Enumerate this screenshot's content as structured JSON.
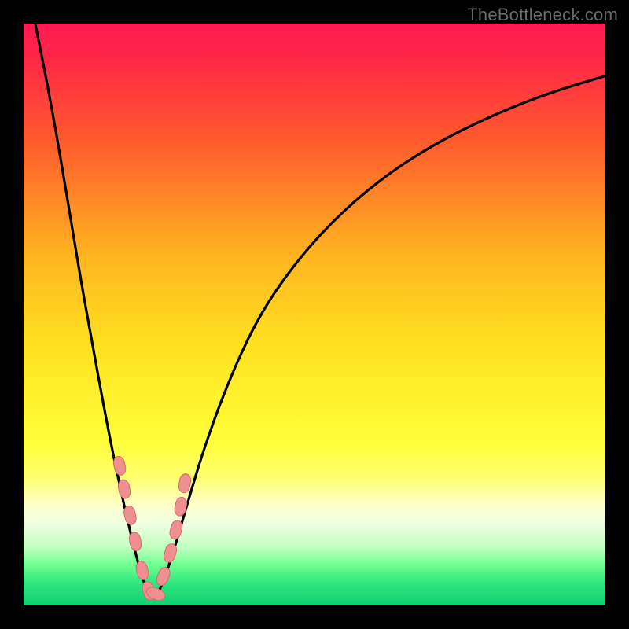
{
  "watermark": {
    "text": "TheBottleneck.com"
  },
  "colors": {
    "black": "#000000",
    "curve": "#000000",
    "marker_fill": "#ef8f8f",
    "marker_stroke": "#d46b6b",
    "gradient_stops": [
      {
        "pos": 0.0,
        "color": "#ff1a52"
      },
      {
        "pos": 0.05,
        "color": "#ff2448"
      },
      {
        "pos": 0.2,
        "color": "#ff5a2e"
      },
      {
        "pos": 0.4,
        "color": "#ffb520"
      },
      {
        "pos": 0.55,
        "color": "#ffe020"
      },
      {
        "pos": 0.72,
        "color": "#ffff3a"
      },
      {
        "pos": 0.78,
        "color": "#ffff70"
      },
      {
        "pos": 0.83,
        "color": "#ffffd0"
      },
      {
        "pos": 0.86,
        "color": "#f0ffe0"
      },
      {
        "pos": 0.9,
        "color": "#c0ffc0"
      },
      {
        "pos": 0.93,
        "color": "#70ff90"
      },
      {
        "pos": 0.96,
        "color": "#30e880"
      },
      {
        "pos": 1.0,
        "color": "#10d070"
      }
    ]
  },
  "chart_data": {
    "type": "line",
    "title": "",
    "xlabel": "",
    "ylabel": "",
    "xlim": [
      0,
      100
    ],
    "ylim": [
      0,
      100
    ],
    "notch_x": 22,
    "series": [
      {
        "name": "bottleneck-curve",
        "x": [
          2,
          4,
          6,
          8,
          10,
          12,
          14,
          16,
          18,
          20,
          21,
          22,
          23,
          24,
          26,
          28,
          31,
          35,
          40,
          46,
          53,
          61,
          70,
          80,
          90,
          100
        ],
        "values": [
          100,
          90,
          79,
          67,
          55,
          44,
          33,
          23,
          14,
          6,
          3,
          1,
          2,
          4,
          10,
          17,
          27,
          38,
          49,
          58,
          66,
          73,
          79,
          84,
          88,
          91
        ]
      }
    ],
    "markers": {
      "name": "highlight-dots",
      "x": [
        16.5,
        17.3,
        18.3,
        19.2,
        20.4,
        21.5,
        22.7,
        24.0,
        25.2,
        26.2,
        27.0,
        27.7
      ],
      "values": [
        24,
        20,
        15.5,
        11,
        6,
        2.5,
        2,
        5,
        9,
        13,
        17,
        21
      ]
    }
  }
}
